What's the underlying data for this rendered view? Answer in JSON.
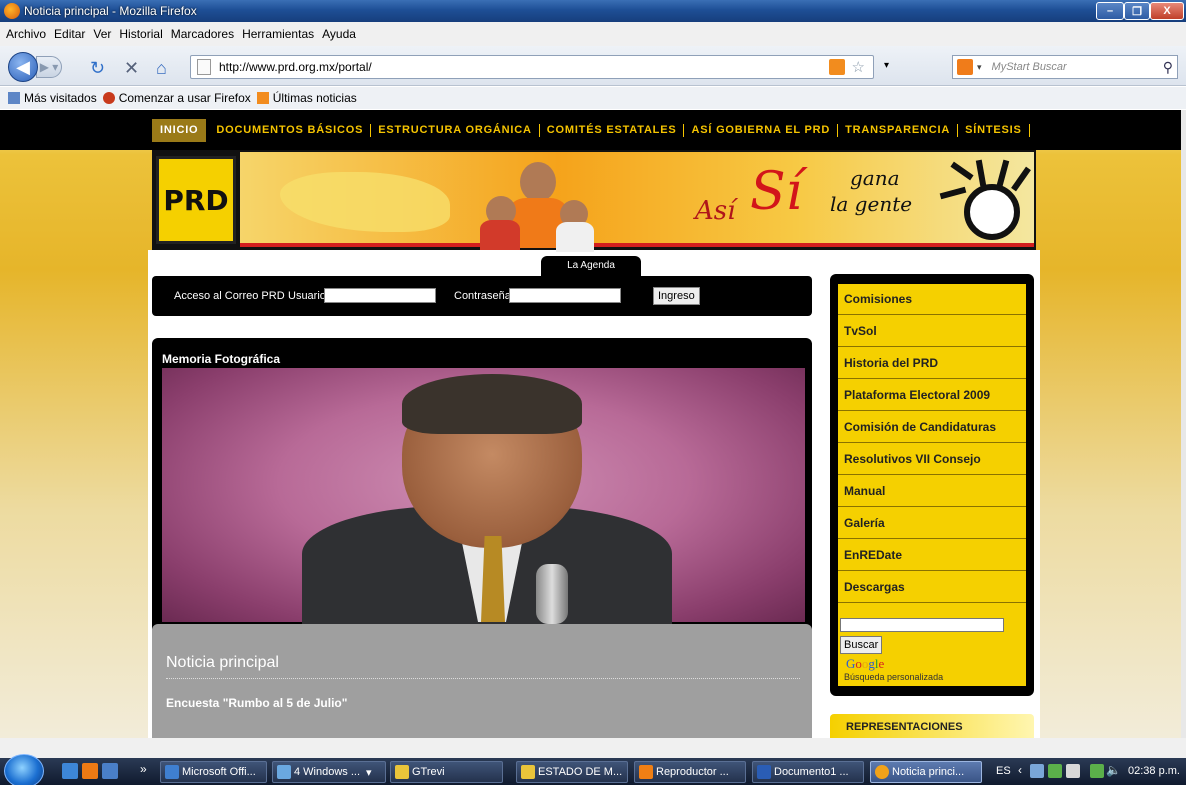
{
  "window": {
    "title": "Noticia principal - Mozilla Firefox",
    "min_label": "–",
    "max_label": "❐",
    "close_label": "X"
  },
  "menu": [
    "Archivo",
    "Editar",
    "Ver",
    "Historial",
    "Marcadores",
    "Herramientas",
    "Ayuda"
  ],
  "toolbar": {
    "url": "http://www.prd.org.mx/portal/",
    "search_placeholder": "MyStart Buscar"
  },
  "bookmarks": [
    "Más visitados",
    "Comenzar a usar Firefox",
    "Últimas noticias"
  ],
  "site": {
    "nav": [
      "INICIO",
      "DOCUMENTOS BÁSICOS",
      "ESTRUCTURA ORGÁNICA",
      "COMITÉS ESTATALES",
      "ASÍ GOBIERNA EL PRD",
      "TRANSPARENCIA",
      "SÍNTESIS"
    ],
    "logo": "PRD",
    "slogan_asi": "Así",
    "slogan_si": "Sí",
    "slogan_gana": "gana",
    "slogan_gente": "la gente",
    "agenda_tab": "La Agenda",
    "login": {
      "label": "Acceso al Correo PRD",
      "user_label": "Usuario",
      "pass_label": "Contraseña",
      "button": "Ingreso"
    },
    "memoria_title": "Memoria Fotográfica",
    "noticia_title": "Noticia principal",
    "noticia_headline": "Encuesta \"Rumbo al 5 de Julio\"",
    "sidebar": [
      "Comisiones",
      "TvSol",
      "Historia del PRD",
      "Plataforma Electoral 2009",
      "Comisión de Candidaturas",
      "Resolutivos VII Consejo",
      "Manual",
      "Galería",
      "EnREDate",
      "Descargas"
    ],
    "search_button": "Buscar",
    "google_sub": "Búsqueda personalizada",
    "representaciones": "REPRESENTACIONES"
  },
  "taskbar": {
    "buttons": [
      "Microsoft Offi...",
      "4 Windows ...",
      "GTrevi",
      "ESTADO DE M...",
      "Reproductor ...",
      "Documento1 ...",
      "Noticia princi..."
    ],
    "lang": "ES",
    "clock": "02:38 p.m."
  }
}
